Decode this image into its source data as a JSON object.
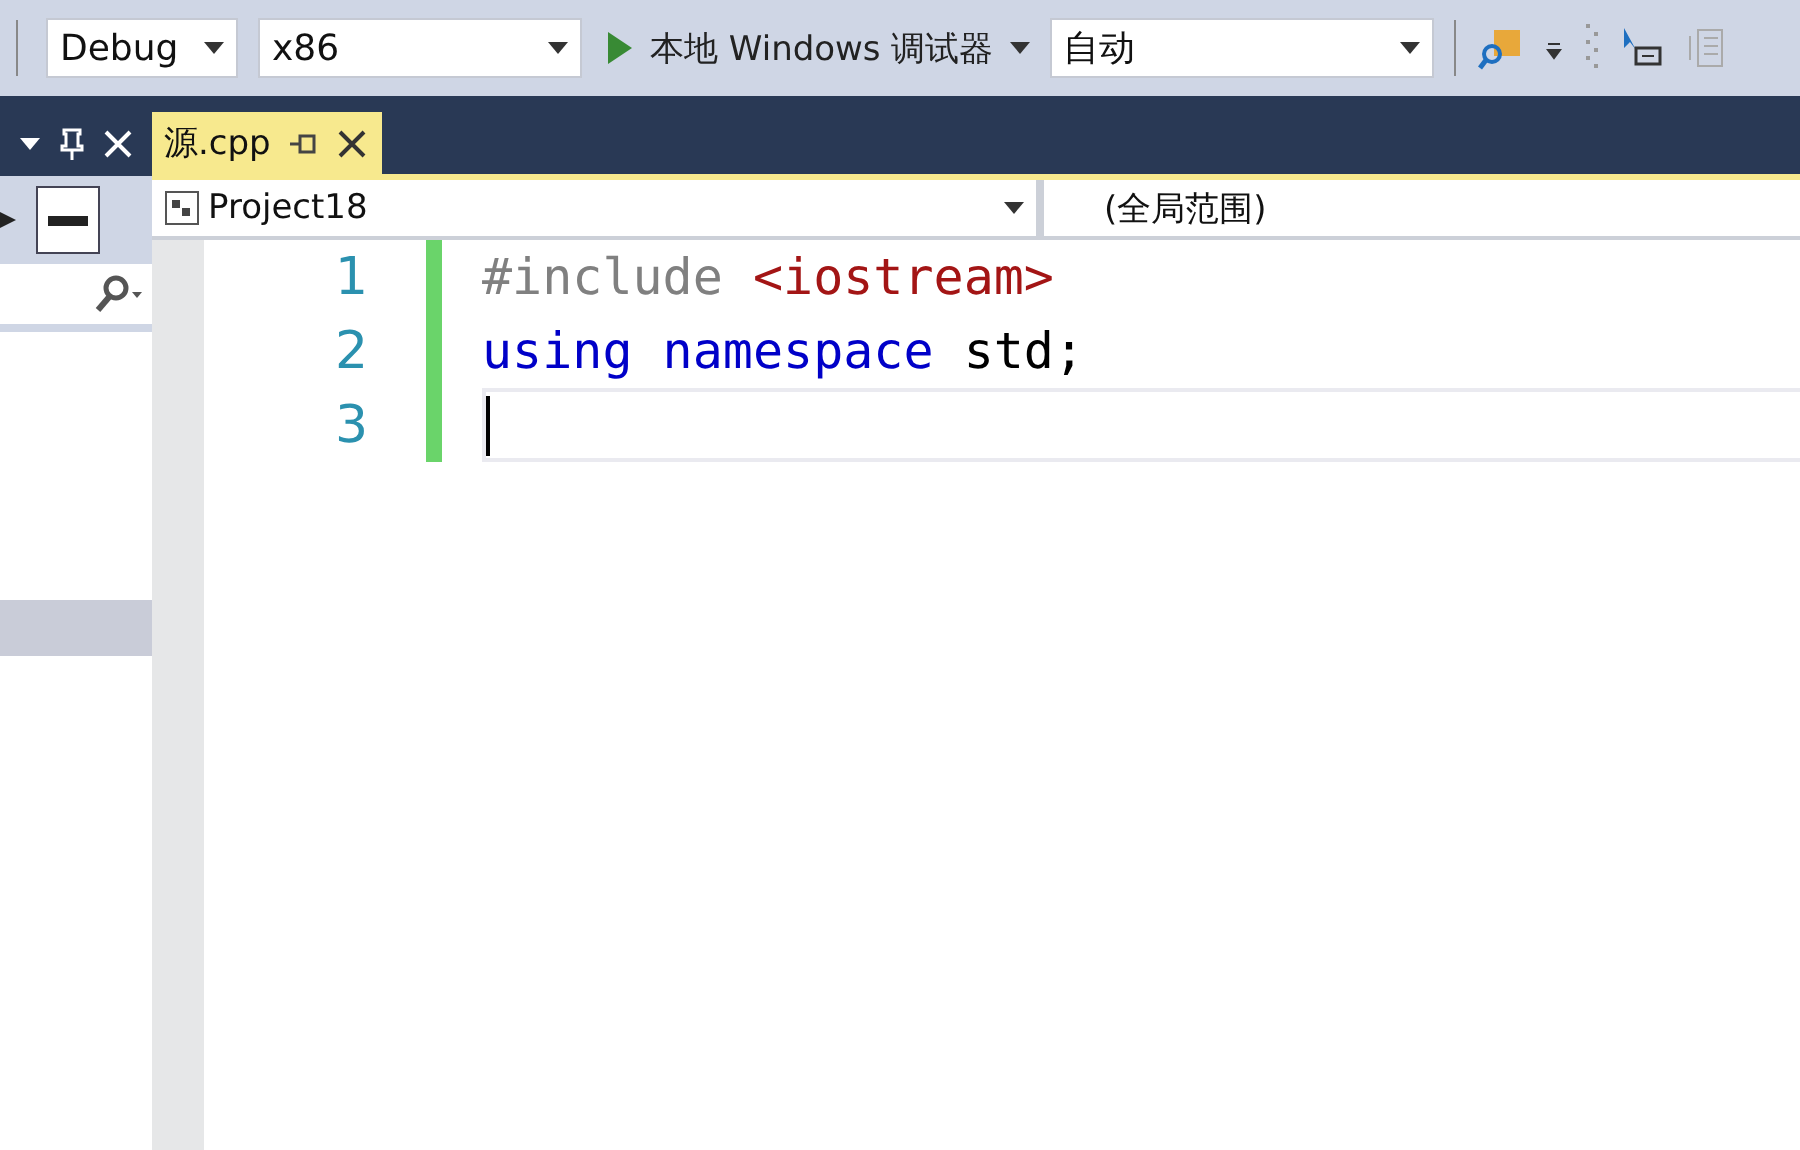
{
  "toolbar": {
    "config": {
      "value": "Debug"
    },
    "platform": {
      "value": "x86"
    },
    "run": {
      "label": "本地 Windows 调试器"
    },
    "mode": {
      "value": "自动"
    }
  },
  "tabs": [
    {
      "label": "源.cpp",
      "selected": true
    }
  ],
  "navigation": {
    "project": "Project18",
    "scope": "(全局范围)"
  },
  "code": [
    {
      "number": "1",
      "modified": true,
      "current": false,
      "tokens": [
        {
          "kind": "directive",
          "text": "#include "
        },
        {
          "kind": "string",
          "text": "<iostream>"
        }
      ]
    },
    {
      "number": "2",
      "modified": true,
      "current": false,
      "tokens": [
        {
          "kind": "keyword",
          "text": "using namespace"
        },
        {
          "kind": "plain",
          "text": " std;"
        }
      ]
    },
    {
      "number": "3",
      "modified": true,
      "current": true
    }
  ]
}
